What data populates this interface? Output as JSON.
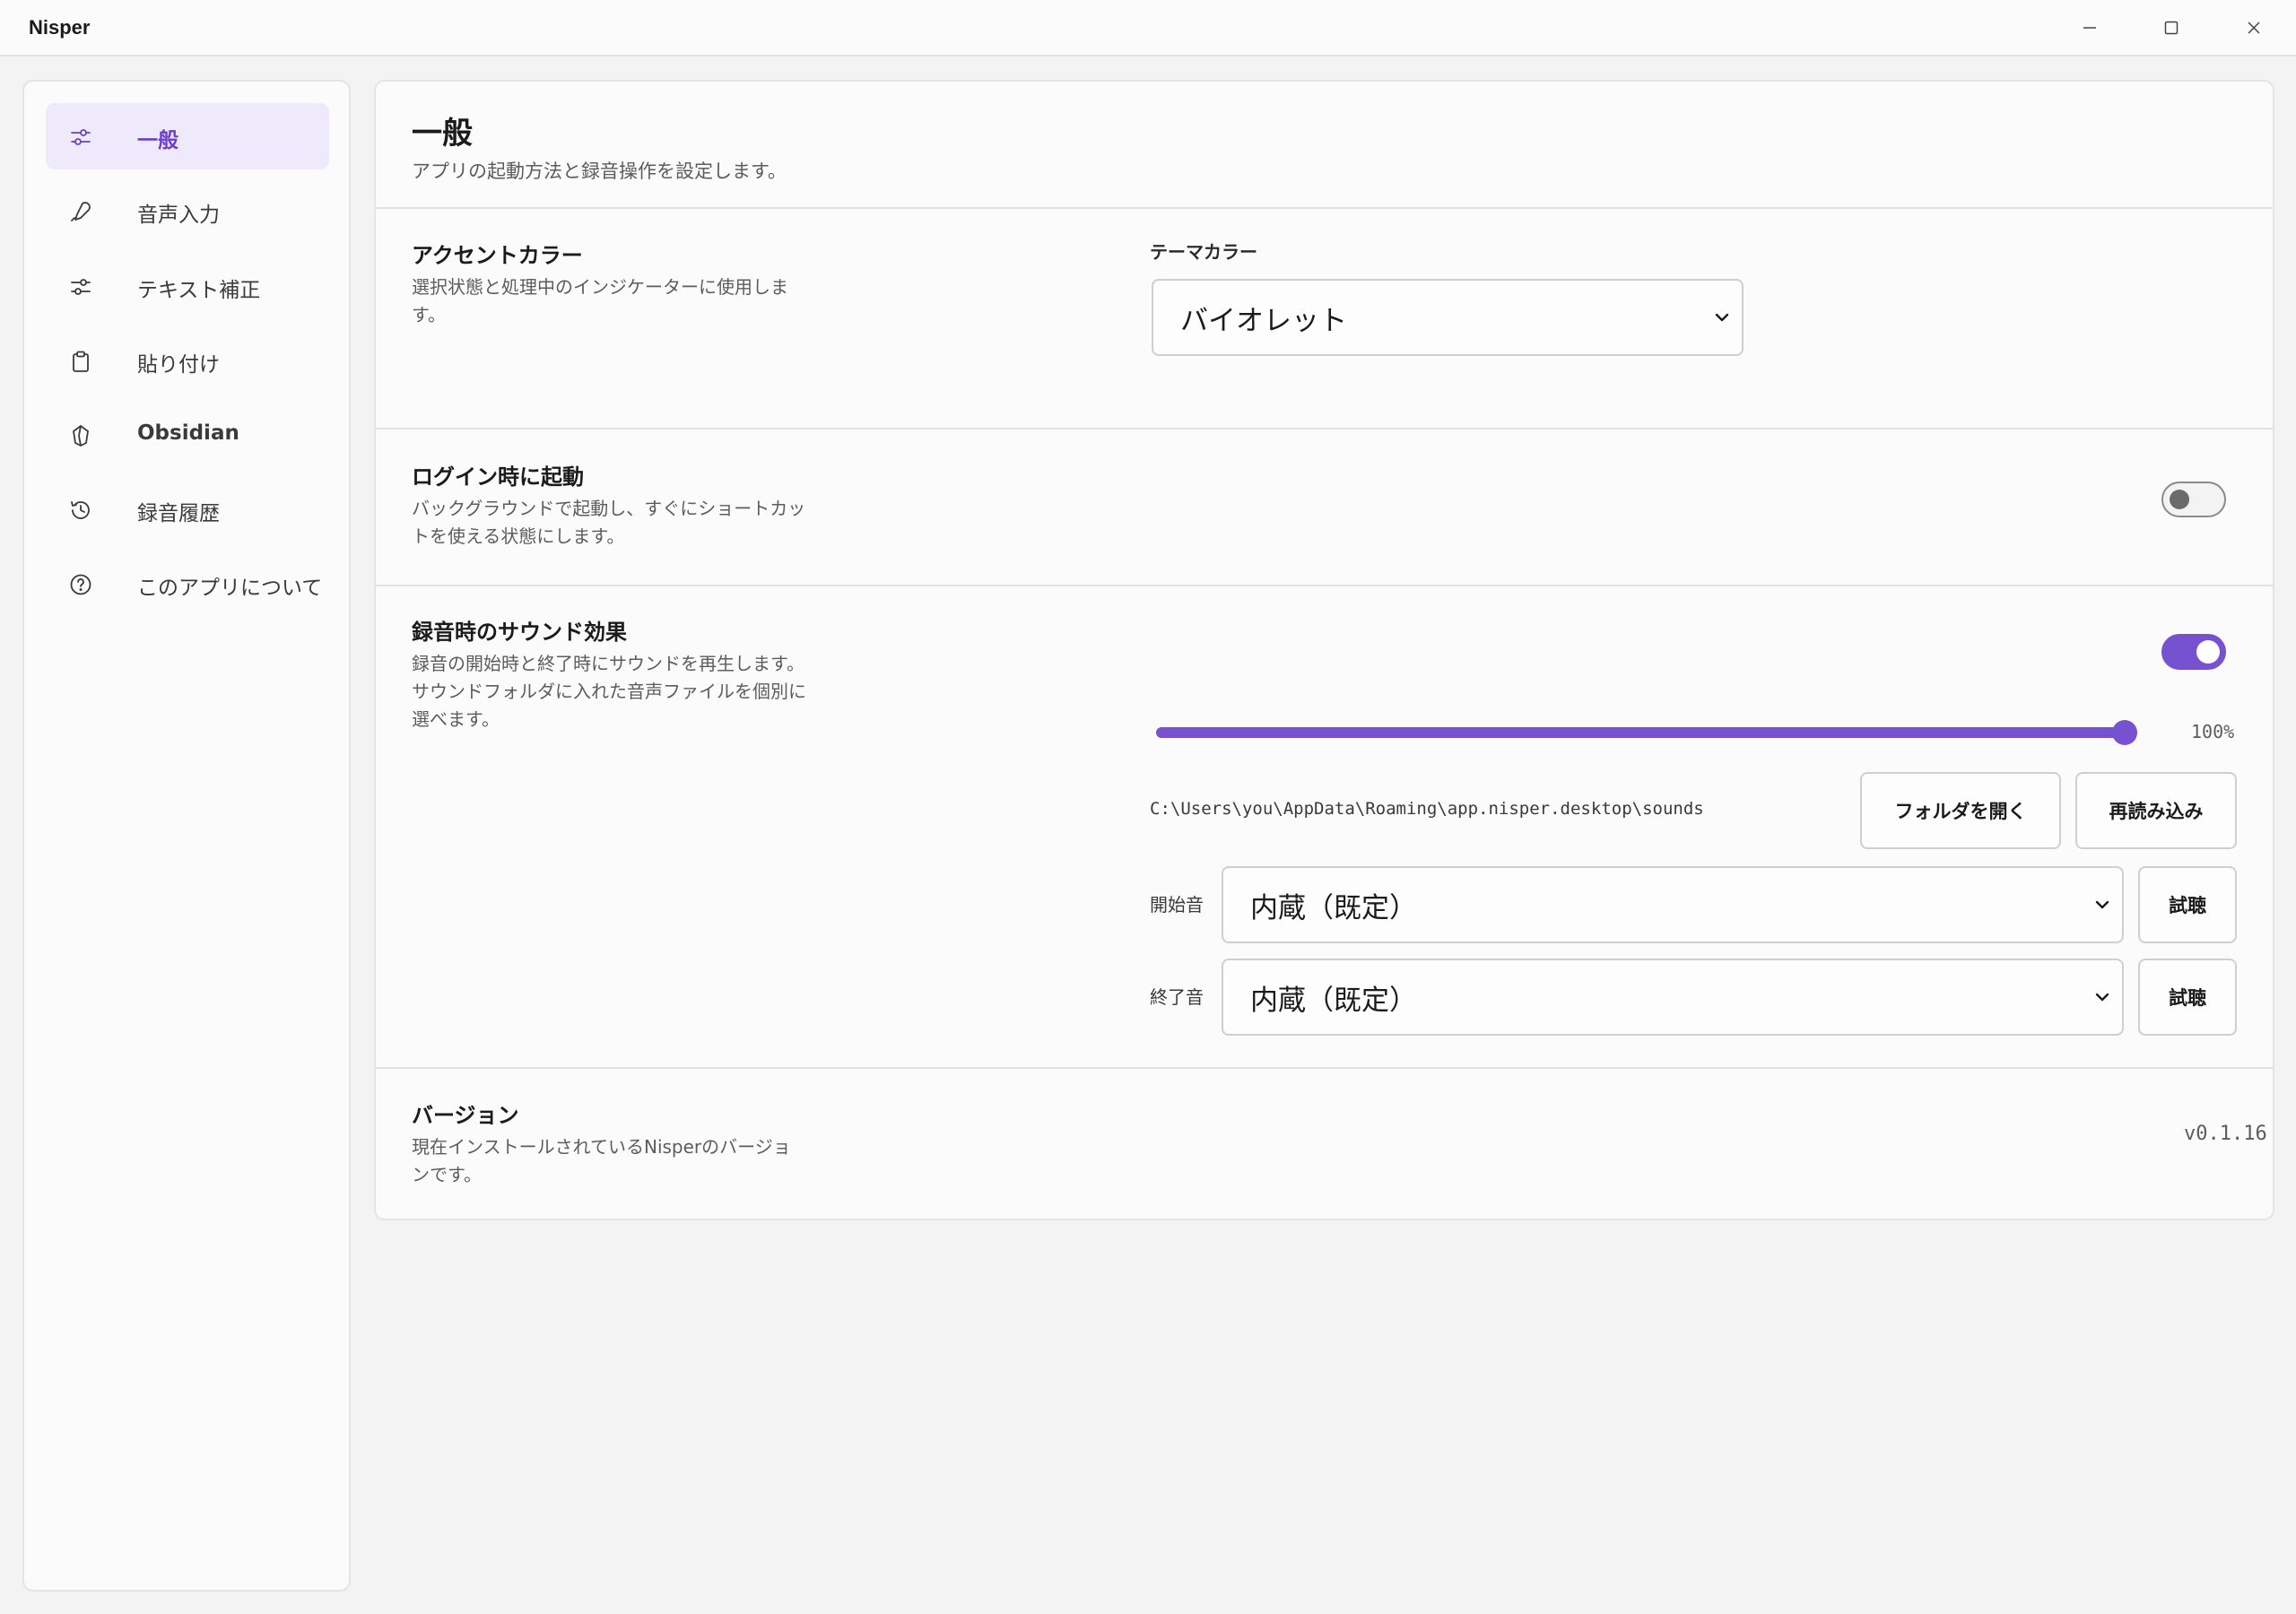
{
  "window": {
    "title": "Nisper"
  },
  "sidebar": {
    "items": [
      {
        "label": "一般",
        "icon": "sliders-icon",
        "active": true
      },
      {
        "label": "音声入力",
        "icon": "pen-mic-icon",
        "active": false
      },
      {
        "label": "テキスト補正",
        "icon": "sliders-icon",
        "active": false
      },
      {
        "label": "貼り付け",
        "icon": "clipboard-icon",
        "active": false
      },
      {
        "label": "Obsidian",
        "icon": "obsidian-icon",
        "active": false
      },
      {
        "label": "録音履歴",
        "icon": "history-icon",
        "active": false
      },
      {
        "label": "このアプリについて",
        "icon": "help-circle-icon",
        "active": false
      }
    ]
  },
  "main": {
    "title": "一般",
    "subtitle": "アプリの起動方法と録音操作を設定します。",
    "accent": {
      "title": "アクセントカラー",
      "description": "選択状態と処理中のインジケーターに使用します。",
      "field_label": "テーマカラー",
      "selected": "バイオレット"
    },
    "login": {
      "title": "ログイン時に起動",
      "description": "バックグラウンドで起動し、すぐにショートカットを使える状態にします。",
      "enabled": false
    },
    "sound": {
      "title": "録音時のサウンド効果",
      "description": "録音の開始時と終了時にサウンドを再生します。サウンドフォルダに入れた音声ファイルを個別に選べます。",
      "enabled": true,
      "volume_percent": 100,
      "volume_label": "100%",
      "folder_path": "C:\\Users\\you\\AppData\\Roaming\\app.nisper.desktop\\sounds",
      "open_folder_label": "フォルダを開く",
      "reload_label": "再読み込み",
      "start_label": "開始音",
      "start_selected": "内蔵（既定）",
      "end_label": "終了音",
      "end_selected": "内蔵（既定）",
      "preview_label": "試聴"
    },
    "version": {
      "title": "バージョン",
      "description": "現在インストールされているNisperのバージョンです。",
      "value": "v0.1.16"
    }
  },
  "colors": {
    "accent": "#7652d1",
    "active_bg": "#efe9fc",
    "active_text": "#6b3fc9"
  }
}
